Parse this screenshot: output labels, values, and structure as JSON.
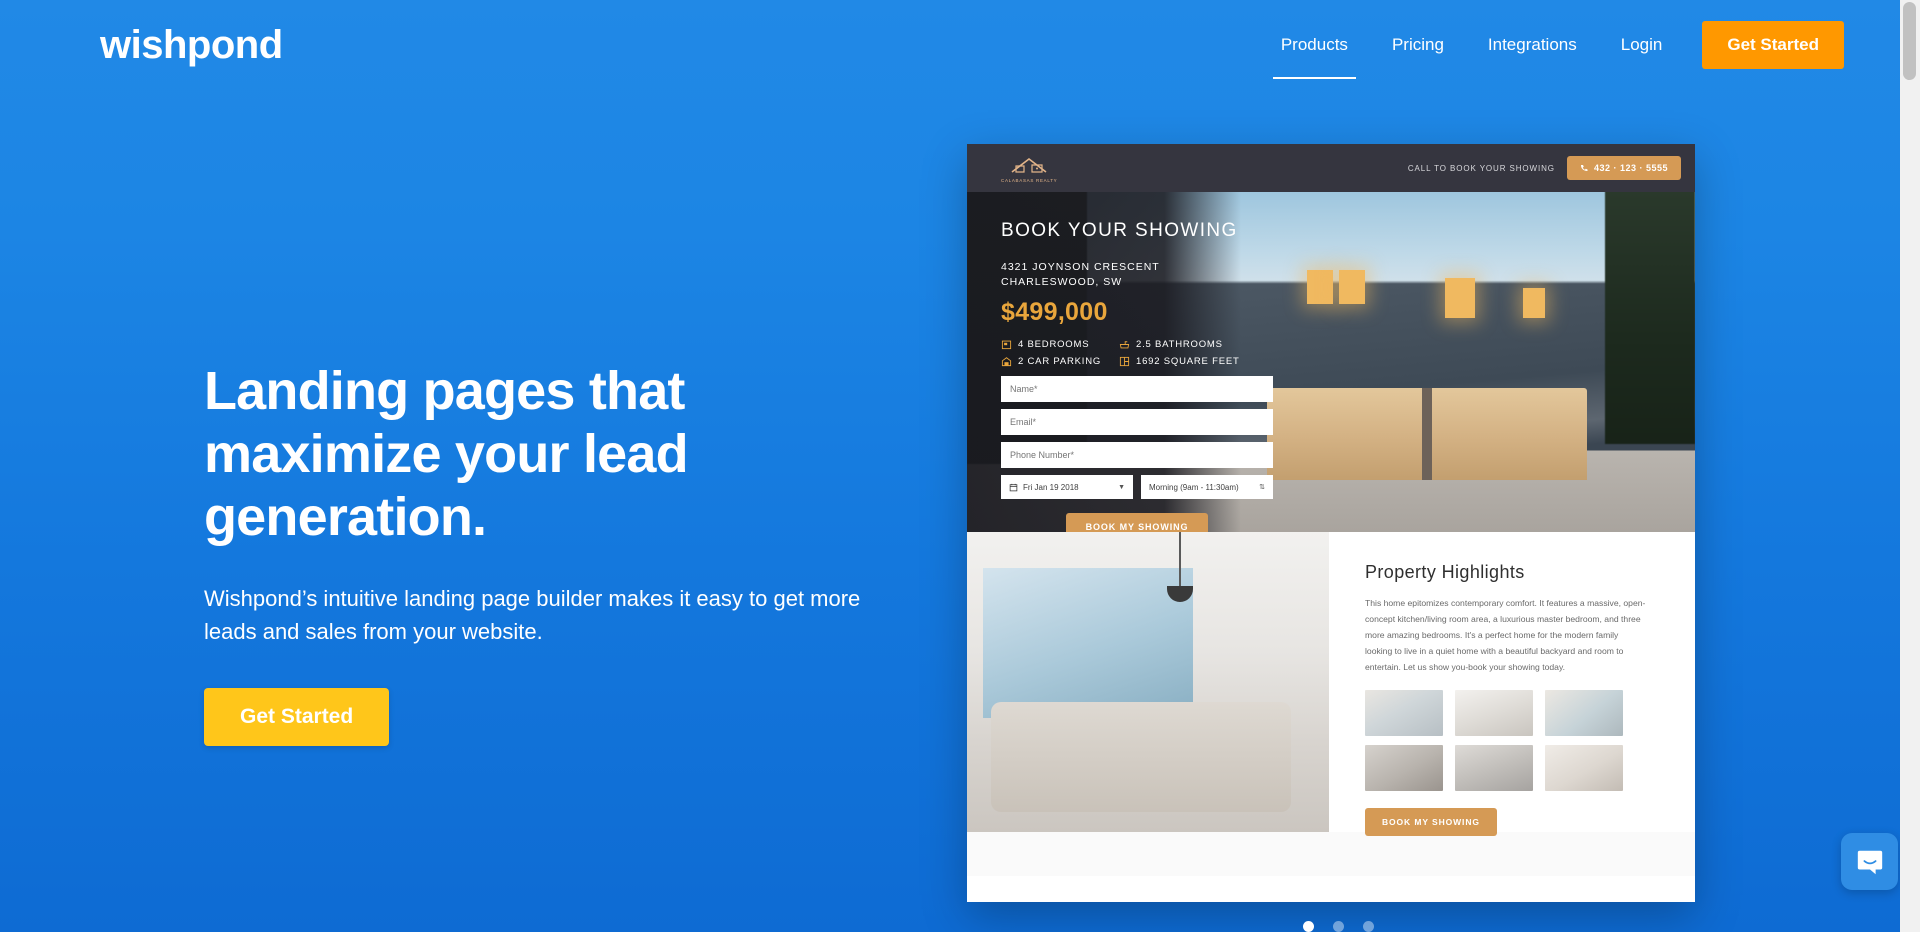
{
  "brand": {
    "logo_text": "wishpond"
  },
  "nav": {
    "links": [
      {
        "label": "Products",
        "active": true
      },
      {
        "label": "Pricing",
        "active": false
      },
      {
        "label": "Integrations",
        "active": false
      },
      {
        "label": "Login",
        "active": false
      }
    ],
    "cta_label": "Get Started"
  },
  "hero": {
    "headline": "Landing pages that maximize your lead generation.",
    "subheadline": "Wishpond’s intuitive landing page builder makes it easy to get more leads and sales from your website.",
    "cta_label": "Get Started"
  },
  "preview": {
    "topbar": {
      "brand_name": "CALABASAS REALTY",
      "call_label": "CALL TO BOOK YOUR SHOWING",
      "phone": "432 · 123 · 5555"
    },
    "hero": {
      "title": "BOOK YOUR SHOWING",
      "address_line1": "4321 JOYNSON CRESCENT",
      "address_line2": "CHARLESWOOD, SW",
      "price": "$499,000",
      "features": [
        {
          "icon": "bed-icon",
          "label": "4 BEDROOMS"
        },
        {
          "icon": "bath-icon",
          "label": "2.5 BATHROOMS"
        },
        {
          "icon": "garage-icon",
          "label": "2 CAR PARKING"
        },
        {
          "icon": "floorplan-icon",
          "label": "1692 SQUARE FEET"
        }
      ]
    },
    "form": {
      "name_placeholder": "Name*",
      "email_placeholder": "Email*",
      "phone_placeholder": "Phone Number*",
      "date_value": "Fri Jan 19 2018",
      "time_value": "Morning (9am - 11:30am)",
      "submit_label": "BOOK MY SHOWING"
    },
    "highlights": {
      "title": "Property Highlights",
      "text": "This home epitomizes contemporary comfort. It features a massive, open-concept kitchen/living room area, a luxurious master bedroom, and three more amazing bedrooms. It's a perfect home for the modern family looking to live in a quiet home with a beautiful backyard and room to entertain. Let us show you-book your showing today.",
      "thumbnails": [
        "living-room-thumb",
        "kitchen-thumb",
        "dining-area-thumb",
        "master-bedroom-thumb",
        "bathroom-thumb",
        "childrens-room-thumb"
      ],
      "book_label": "BOOK MY SHOWING"
    }
  },
  "carousel": {
    "dots": 3,
    "active_index": 0
  },
  "chat": {
    "icon": "chat-bubble-icon"
  },
  "colors": {
    "background_blue": "#1C85E4",
    "nav_cta_orange": "#FF9800",
    "hero_cta_yellow": "#FFC61A",
    "preview_accent": "#d59a55",
    "price_gold": "#e9a63c"
  }
}
